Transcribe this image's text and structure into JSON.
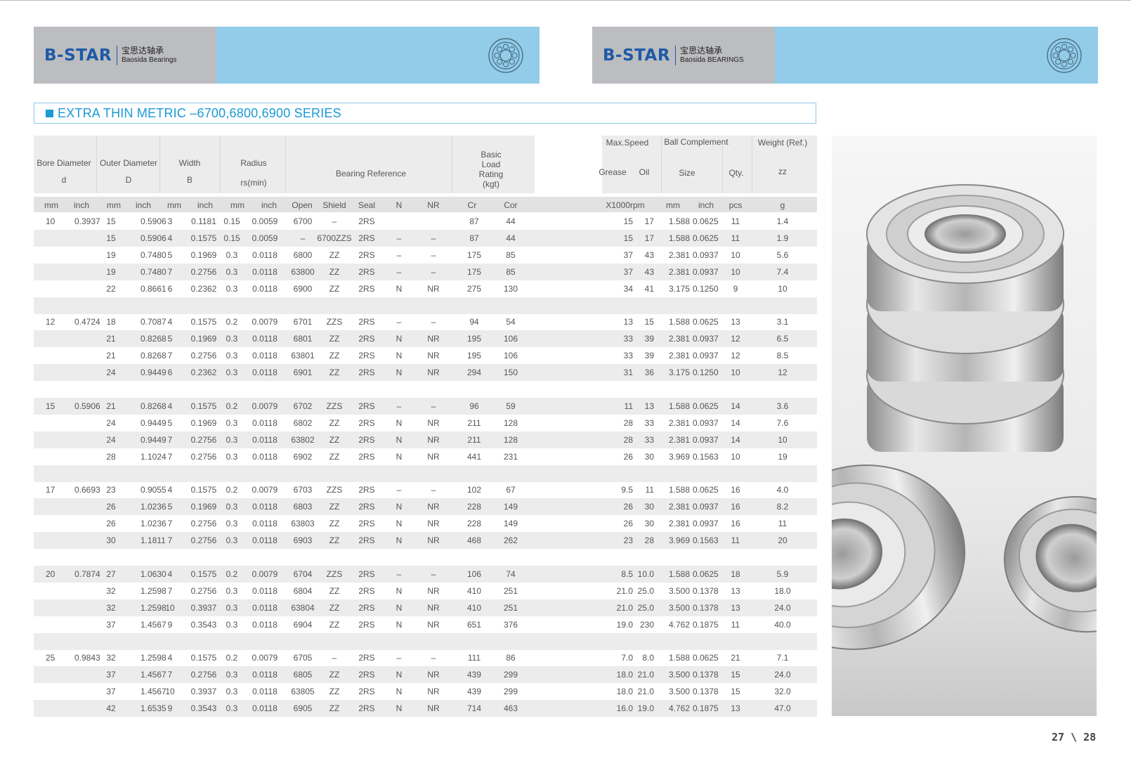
{
  "brand": {
    "left": {
      "name": "B-STAR",
      "cn": "宝思达轴承",
      "en": "Baosida Bearings"
    },
    "right": {
      "name": "B-STAR",
      "cn": "宝思达轴承",
      "en": "Baosida BEARINGS"
    }
  },
  "section_title": "EXTRA THIN METRIC –6700,6800,6900 SERIES",
  "headers": {
    "bore": "Bore  Diameter",
    "bore_sym": "d",
    "outer": "Outer Diameter",
    "outer_sym": "D",
    "width": "Width",
    "width_sym": "B",
    "radius": "Radius",
    "radius_sym": "rs(min)",
    "bearing_ref": "Bearing Reference",
    "load_rating": [
      "Basic",
      "Load",
      "Rating",
      "(kgt)"
    ],
    "max_speed": "Max.Speed",
    "grease": "Grease",
    "oil": "Oil",
    "ball_complement": "Ball Complement",
    "size": "Size",
    "qty": "Qty.",
    "weight": "Weight  (Ref.)",
    "weight_sym": "zz"
  },
  "units": [
    "mm",
    "inch",
    "mm",
    "inch",
    "mm",
    "inch",
    "mm",
    "inch",
    "Open",
    "Shield",
    "Seal",
    "N",
    "NR",
    "Cr",
    "Cor",
    "X1000rpm",
    "mm",
    "inch",
    "pcs",
    "g"
  ],
  "groups": [
    {
      "rows": [
        [
          "10",
          "0.3937",
          "15",
          "0.5906",
          "3",
          "0.1181",
          "0.15",
          "0.0059",
          "6700",
          "–",
          "2RS",
          "",
          "",
          "87",
          "44",
          "15",
          "17",
          "1.588",
          "0.0625",
          "11",
          "1.4"
        ],
        [
          "",
          "",
          "15",
          "0.5906",
          "4",
          "0.1575",
          "0.15",
          "0.0059",
          "–",
          "6700ZZS",
          "2RS",
          "–",
          "–",
          "87",
          "44",
          "15",
          "17",
          "1.588",
          "0.0625",
          "11",
          "1.9"
        ],
        [
          "",
          "",
          "19",
          "0.7480",
          "5",
          "0.1969",
          "0.3",
          "0.0118",
          "6800",
          "ZZ",
          "2RS",
          "–",
          "–",
          "175",
          "85",
          "37",
          "43",
          "2.381",
          "0.0937",
          "10",
          "5.6"
        ],
        [
          "",
          "",
          "19",
          "0.7480",
          "7",
          "0.2756",
          "0.3",
          "0.0118",
          "63800",
          "ZZ",
          "2RS",
          "–",
          "–",
          "175",
          "85",
          "37",
          "43",
          "2.381",
          "0.0937",
          "10",
          "7.4"
        ],
        [
          "",
          "",
          "22",
          "0.8661",
          "6",
          "0.2362",
          "0.3",
          "0.0118",
          "6900",
          "ZZ",
          "2RS",
          "N",
          "NR",
          "275",
          "130",
          "34",
          "41",
          "3.175",
          "0.1250",
          "9",
          "10"
        ]
      ]
    },
    {
      "rows": [
        [
          "12",
          "0.4724",
          "18",
          "0.7087",
          "4",
          "0.1575",
          "0.2",
          "0.0079",
          "6701",
          "ZZS",
          "2RS",
          "–",
          "–",
          "94",
          "54",
          "13",
          "15",
          "1.588",
          "0.0625",
          "13",
          "3.1"
        ],
        [
          "",
          "",
          "21",
          "0.8268",
          "5",
          "0.1969",
          "0.3",
          "0.0118",
          "6801",
          "ZZ",
          "2RS",
          "N",
          "NR",
          "195",
          "106",
          "33",
          "39",
          "2.381",
          "0.0937",
          "12",
          "6.5"
        ],
        [
          "",
          "",
          "21",
          "0.8268",
          "7",
          "0.2756",
          "0.3",
          "0.0118",
          "63801",
          "ZZ",
          "2RS",
          "N",
          "NR",
          "195",
          "106",
          "33",
          "39",
          "2.381",
          "0.0937",
          "12",
          "8.5"
        ],
        [
          "",
          "",
          "24",
          "0.9449",
          "6",
          "0.2362",
          "0.3",
          "0.0118",
          "6901",
          "ZZ",
          "2RS",
          "N",
          "NR",
          "294",
          "150",
          "31",
          "36",
          "3.175",
          "0.1250",
          "10",
          "12"
        ]
      ]
    },
    {
      "rows": [
        [
          "15",
          "0.5906",
          "21",
          "0.8268",
          "4",
          "0.1575",
          "0.2",
          "0.0079",
          "6702",
          "ZZS",
          "2RS",
          "–",
          "–",
          "96",
          "59",
          "11",
          "13",
          "1.588",
          "0.0625",
          "14",
          "3.6"
        ],
        [
          "",
          "",
          "24",
          "0.9449",
          "5",
          "0.1969",
          "0.3",
          "0.0118",
          "6802",
          "ZZ",
          "2RS",
          "N",
          "NR",
          "211",
          "128",
          "28",
          "33",
          "2.381",
          "0.0937",
          "14",
          "7.6"
        ],
        [
          "",
          "",
          "24",
          "0.9449",
          "7",
          "0.2756",
          "0.3",
          "0.0118",
          "63802",
          "ZZ",
          "2RS",
          "N",
          "NR",
          "211",
          "128",
          "28",
          "33",
          "2.381",
          "0.0937",
          "14",
          "10"
        ],
        [
          "",
          "",
          "28",
          "1.1024",
          "7",
          "0.2756",
          "0.3",
          "0.0118",
          "6902",
          "ZZ",
          "2RS",
          "N",
          "NR",
          "441",
          "231",
          "26",
          "30",
          "3.969",
          "0.1563",
          "10",
          "19"
        ]
      ]
    },
    {
      "rows": [
        [
          "17",
          "0.6693",
          "23",
          "0.9055",
          "4",
          "0.1575",
          "0.2",
          "0.0079",
          "6703",
          "ZZS",
          "2RS",
          "–",
          "–",
          "102",
          "67",
          "9.5",
          "11",
          "1.588",
          "0.0625",
          "16",
          "4.0"
        ],
        [
          "",
          "",
          "26",
          "1.0236",
          "5",
          "0.1969",
          "0.3",
          "0.0118",
          "6803",
          "ZZ",
          "2RS",
          "N",
          "NR",
          "228",
          "149",
          "26",
          "30",
          "2.381",
          "0.0937",
          "16",
          "8.2"
        ],
        [
          "",
          "",
          "26",
          "1.0236",
          "7",
          "0.2756",
          "0.3",
          "0.0118",
          "63803",
          "ZZ",
          "2RS",
          "N",
          "NR",
          "228",
          "149",
          "26",
          "30",
          "2.381",
          "0.0937",
          "16",
          "11"
        ],
        [
          "",
          "",
          "30",
          "1.1811",
          "7",
          "0.2756",
          "0.3",
          "0.0118",
          "6903",
          "ZZ",
          "2RS",
          "N",
          "NR",
          "468",
          "262",
          "23",
          "28",
          "3.969",
          "0.1563",
          "11",
          "20"
        ]
      ]
    },
    {
      "rows": [
        [
          "20",
          "0.7874",
          "27",
          "1.0630",
          "4",
          "0.1575",
          "0.2",
          "0.0079",
          "6704",
          "ZZS",
          "2RS",
          "–",
          "–",
          "106",
          "74",
          "8.5",
          "10.0",
          "1.588",
          "0.0625",
          "18",
          "5.9"
        ],
        [
          "",
          "",
          "32",
          "1.2598",
          "7",
          "0.2756",
          "0.3",
          "0.0118",
          "6804",
          "ZZ",
          "2RS",
          "N",
          "NR",
          "410",
          "251",
          "21.0",
          "25.0",
          "3.500",
          "0.1378",
          "13",
          "18.0"
        ],
        [
          "",
          "",
          "32",
          "1.2598",
          "10",
          "0.3937",
          "0.3",
          "0.0118",
          "63804",
          "ZZ",
          "2RS",
          "N",
          "NR",
          "410",
          "251",
          "21.0",
          "25.0",
          "3.500",
          "0.1378",
          "13",
          "24.0"
        ],
        [
          "",
          "",
          "37",
          "1.4567",
          "9",
          "0.3543",
          "0.3",
          "0.0118",
          "6904",
          "ZZ",
          "2RS",
          "N",
          "NR",
          "651",
          "376",
          "19.0",
          "230",
          "4.762",
          "0.1875",
          "11",
          "40.0"
        ]
      ]
    },
    {
      "rows": [
        [
          "25",
          "0.9843",
          "32",
          "1.2598",
          "4",
          "0.1575",
          "0.2",
          "0.0079",
          "6705",
          "–",
          "2RS",
          "–",
          "–",
          "111",
          "86",
          "7.0",
          "8.0",
          "1.588",
          "0.0625",
          "21",
          "7.1"
        ],
        [
          "",
          "",
          "37",
          "1.4567",
          "7",
          "0.2756",
          "0.3",
          "0.0118",
          "6805",
          "ZZ",
          "2RS",
          "N",
          "NR",
          "439",
          "299",
          "18.0",
          "21.0",
          "3.500",
          "0.1378",
          "15",
          "24.0"
        ],
        [
          "",
          "",
          "37",
          "1.4567",
          "10",
          "0.3937",
          "0.3",
          "0.0118",
          "63805",
          "ZZ",
          "2RS",
          "N",
          "NR",
          "439",
          "299",
          "18.0",
          "21.0",
          "3.500",
          "0.1378",
          "15",
          "32.0"
        ],
        [
          "",
          "",
          "42",
          "1.6535",
          "9",
          "0.3543",
          "0.3",
          "0.0118",
          "6905",
          "ZZ",
          "2RS",
          "N",
          "NR",
          "714",
          "463",
          "16.0",
          "19.0",
          "4.762",
          "0.1875",
          "13",
          "47.0"
        ]
      ]
    }
  ],
  "page_number": "27 \\ 28"
}
